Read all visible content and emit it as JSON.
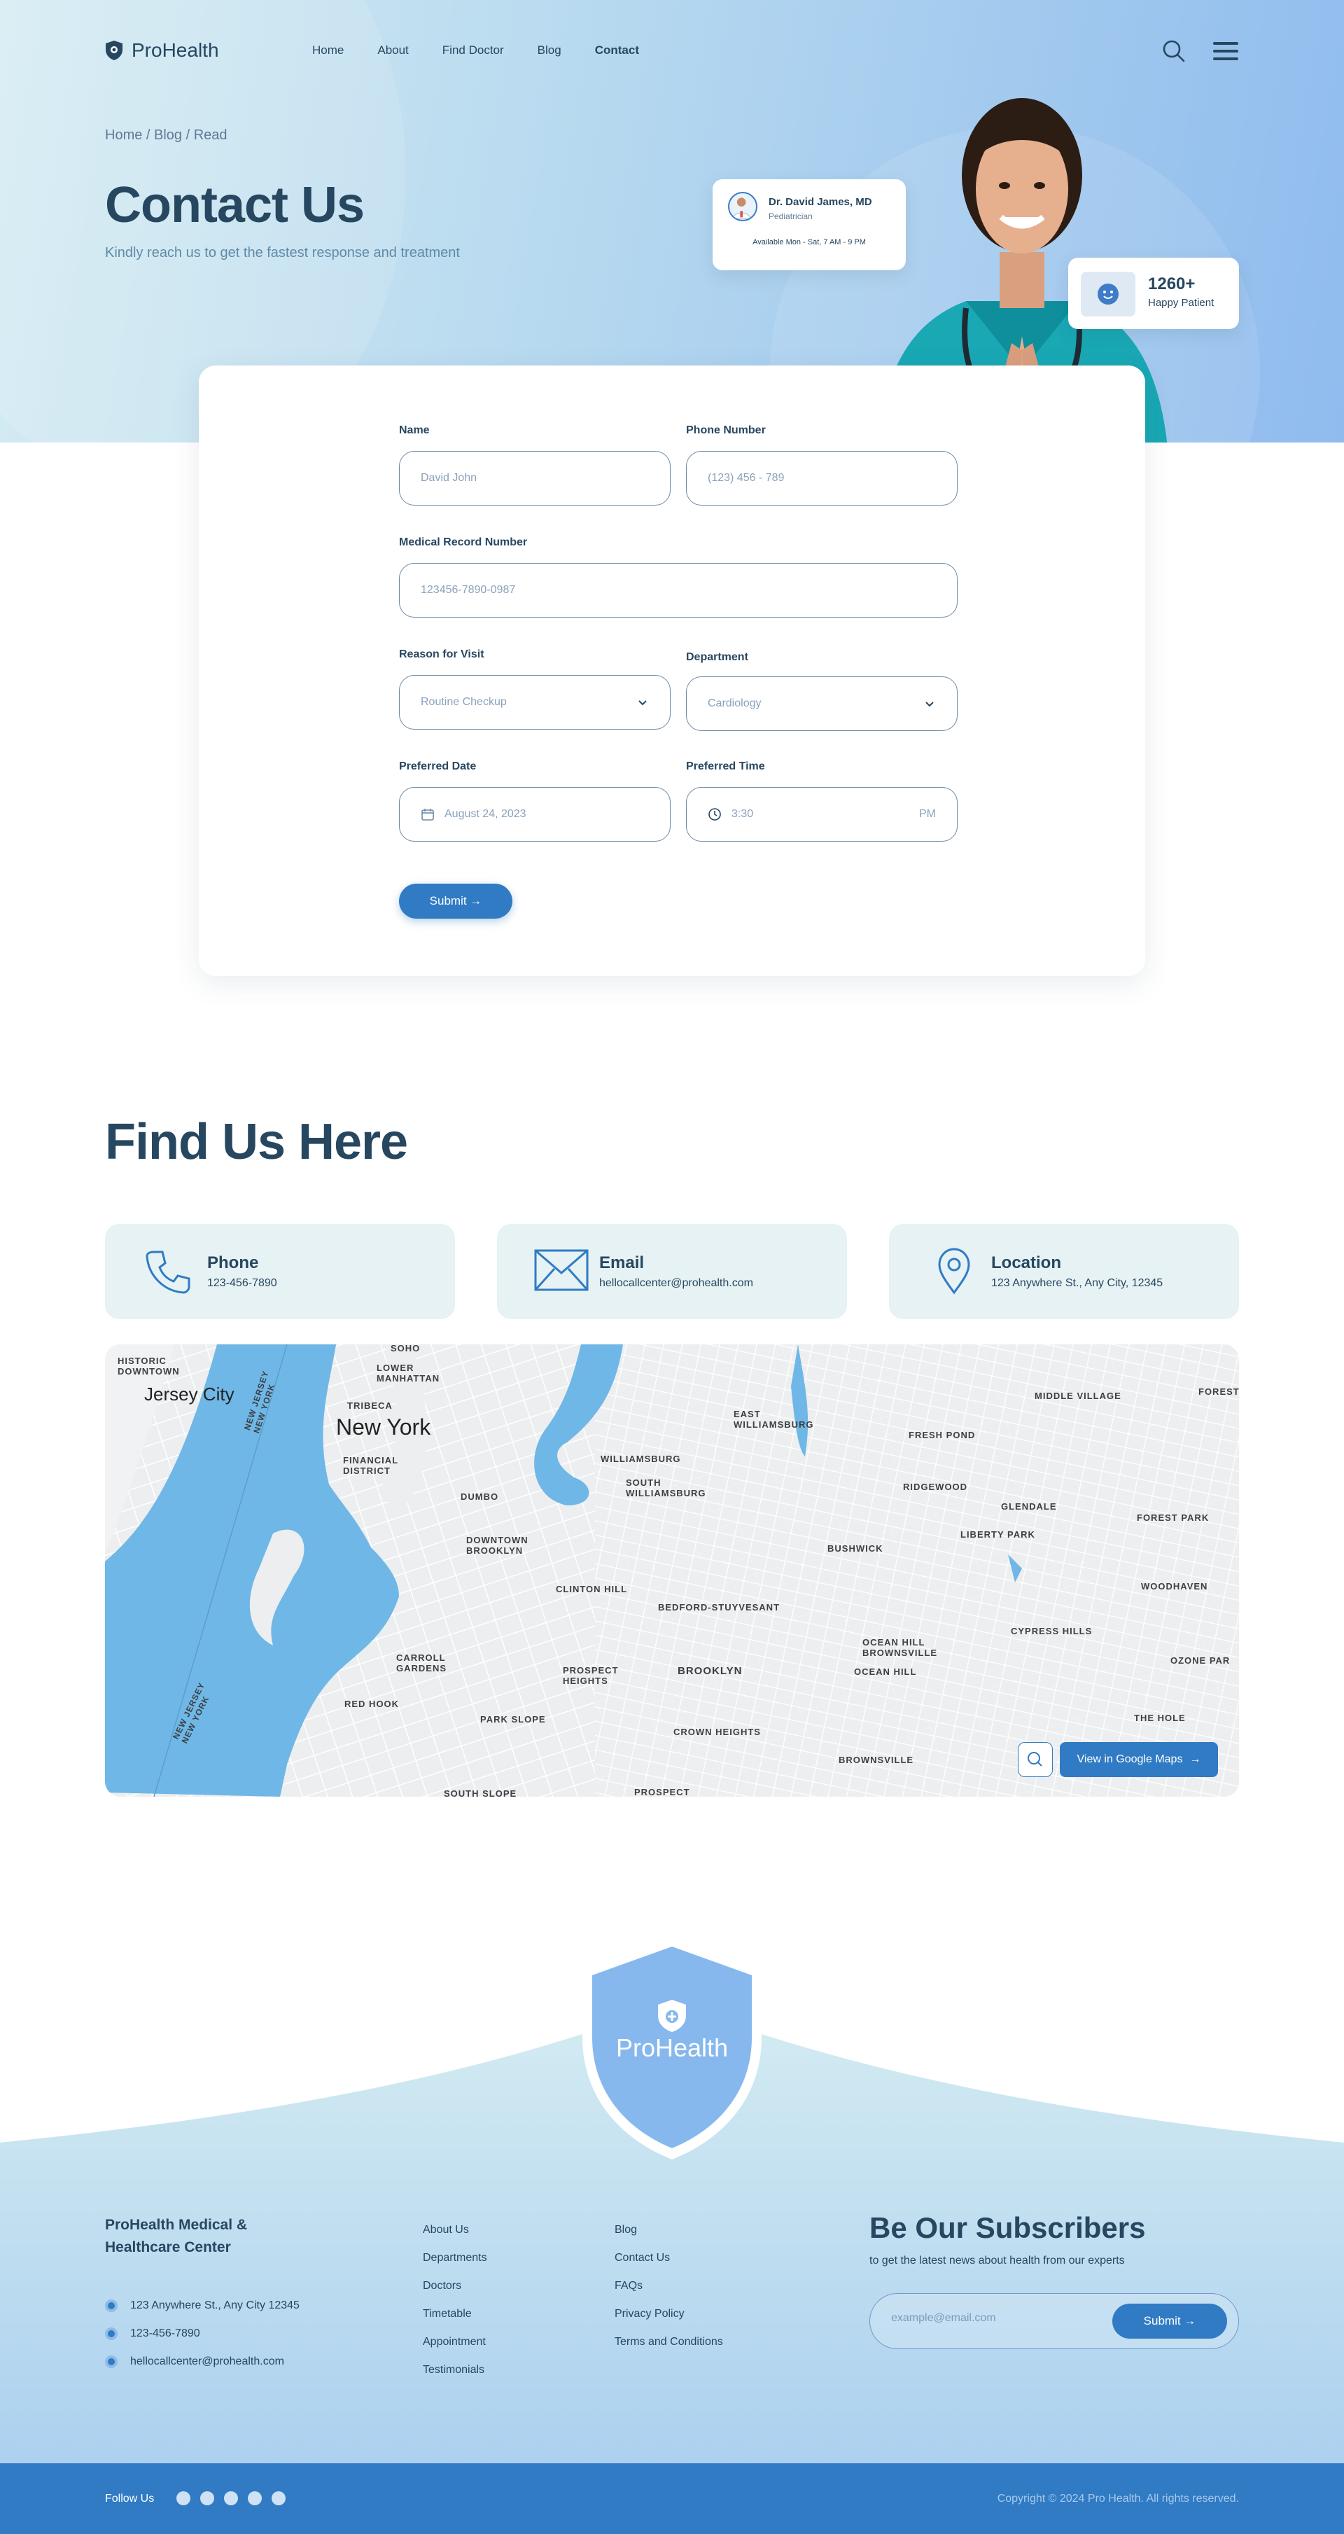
{
  "brand": {
    "name": "ProHealth"
  },
  "nav": {
    "items": [
      "Home",
      "About",
      "Find Doctor",
      "Blog",
      "Contact"
    ],
    "active": "Contact"
  },
  "breadcrumb": "Home / Blog / Read",
  "hero": {
    "title": "Contact Us",
    "subtitle": "Kindly reach us to get the fastest response and treatment"
  },
  "doctor_card": {
    "name": "Dr. David James, MD",
    "specialty": "Pediatrician",
    "availability": "Available Mon - Sat, 7 AM - 9 PM"
  },
  "patient_card": {
    "count": "1260+",
    "label": "Happy Patient"
  },
  "form": {
    "name_label": "Name",
    "name_placeholder": "David John",
    "phone_label": "Phone Number",
    "phone_placeholder": "(123) 456 - 789",
    "mrn_label": "Medical Record Number",
    "mrn_placeholder": "123456-7890-0987",
    "reason_label": "Reason for Visit",
    "reason_value": "Routine Checkup",
    "department_label": "Department",
    "department_value": "Cardiology",
    "date_label": "Preferred Date",
    "date_value": "August 24, 2023",
    "time_label": "Preferred Time",
    "time_value": "3:30",
    "time_ampm": "PM",
    "submit_label": "Submit →"
  },
  "find_us": {
    "title": "Find Us Here",
    "cards": [
      {
        "title": "Phone",
        "value": "123-456-7890",
        "icon": "phone-icon"
      },
      {
        "title": "Email",
        "value": "hellocallcenter@prohealth.com",
        "icon": "mail-icon"
      },
      {
        "title": "Location",
        "value": "123 Anywhere St., Any City, 12345",
        "icon": "location-pin-icon"
      }
    ]
  },
  "map": {
    "labels": {
      "historic": "HISTORIC\nDOWNTOWN",
      "jersey": "Jersey City",
      "soho": "SOHO",
      "lower_manhattan": "LOWER\nMANHATTAN",
      "tribeca": "TRIBECA",
      "new_york": "New York",
      "financial": "FINANCIAL\nDISTRICT",
      "dumbo": "DUMBO",
      "downtown_bk": "DOWNTOWN\nBROOKLYN",
      "williamsburg": "WILLIAMSBURG",
      "south_williamsburg": "SOUTH\nWILLIAMSBURG",
      "east_williamsburg": "EAST\nWILLIAMSBURG",
      "middle_village": "MIDDLE VILLAGE",
      "fresh_pond": "FRESH POND",
      "ridgewood": "RIDGEWOOD",
      "glendale": "GLENDALE",
      "forest_park": "FOREST PARK",
      "forest": "FOREST",
      "liberty_park": "LIBERTY PARK",
      "bushwick": "BUSHWICK",
      "clinton_hill": "CLINTON HILL",
      "bedford": "BEDFORD-STUYVESANT",
      "woodhaven": "WOODHAVEN",
      "cypress_hills": "CYPRESS HILLS",
      "ozone_park": "OZONE PAR",
      "ocean_hill_bv": "OCEAN HILL\nBROWNSVILLE",
      "ocean_hill": "OCEAN HILL",
      "carroll": "CARROLL\nGARDENS",
      "prospect_heights": "PROSPECT\nHEIGHTS",
      "brooklyn": "BROOKLYN",
      "red_hook": "RED HOOK",
      "park_slope": "PARK SLOPE",
      "crown_heights": "CROWN HEIGHTS",
      "the_hole": "THE HOLE",
      "brownsville": "BROWNSVILLE",
      "south_slope": "SOUTH SLOPE",
      "prospect": "PROSPECT",
      "nj_ny_1": "NEW JERSEY\nNEW YORK",
      "nj_ny_2": "NEW JERSEY\nNEW YORK"
    },
    "button_label": "View in Google Maps"
  },
  "footer": {
    "badge_text": "ProHealth",
    "company": "ProHealth Medical &\nHealthcare Center",
    "info": [
      "123 Anywhere St., Any City 12345",
      "123-456-7890",
      "hellocallcenter@prohealth.com"
    ],
    "links_col1": [
      "About Us",
      "Departments",
      "Doctors",
      "Timetable",
      "Appointment",
      "Testimonials"
    ],
    "links_col2": [
      "Blog",
      "Contact Us",
      "FAQs",
      "Privacy Policy",
      "Terms and Conditions"
    ],
    "subscribe": {
      "title": "Be Our Subscribers",
      "text": "to get the latest news about health from our experts",
      "placeholder": "example@email.com",
      "button": "Submit →"
    },
    "follow": "Follow Us",
    "copyright": "Copyright © 2024 Pro Health. All rights reserved.",
    "socials": [
      "facebook-icon",
      "youtube-icon",
      "linkedin-icon",
      "twitter-icon",
      "instagram-icon"
    ]
  },
  "colors": {
    "primary": "#307bc4",
    "dark": "#274760",
    "light_card": "#e6f2f4",
    "water": "#6fb7e6"
  }
}
